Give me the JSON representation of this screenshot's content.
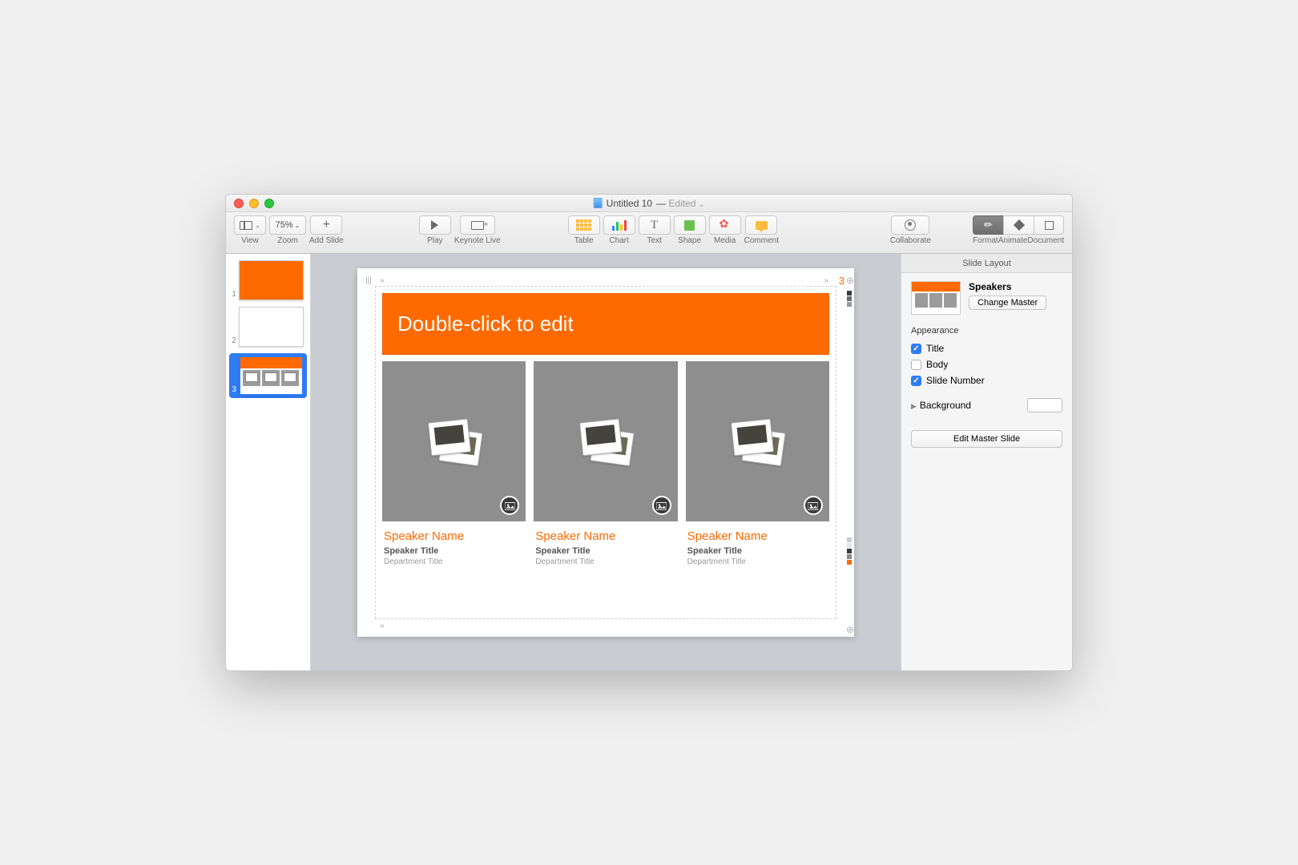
{
  "title": {
    "name": "Untitled 10",
    "status": "Edited"
  },
  "toolbar": {
    "left": {
      "view": "View",
      "zoom_value": "75%",
      "zoom": "Zoom",
      "add_slide": "Add Slide"
    },
    "play": {
      "play": "Play",
      "keynote_live": "Keynote Live"
    },
    "insert": {
      "table": "Table",
      "chart": "Chart",
      "text": "Text",
      "shape": "Shape",
      "media": "Media",
      "comment": "Comment"
    },
    "collab": {
      "collaborate": "Collaborate"
    },
    "right": {
      "format": "Format",
      "animate": "Animate",
      "document": "Document"
    }
  },
  "slidenav": {
    "items": [
      "1",
      "2",
      "3"
    ],
    "selected": 3
  },
  "slide": {
    "number": "3",
    "title_placeholder": "Double-click to edit",
    "speakers": [
      {
        "name": "Speaker Name",
        "title": "Speaker Title",
        "dept": "Department Title"
      },
      {
        "name": "Speaker Name",
        "title": "Speaker Title",
        "dept": "Department Title"
      },
      {
        "name": "Speaker Name",
        "title": "Speaker Title",
        "dept": "Department Title"
      }
    ]
  },
  "inspector": {
    "header": "Slide Layout",
    "master_name": "Speakers",
    "change_master": "Change Master",
    "appearance": "Appearance",
    "checks": {
      "title": "Title",
      "body": "Body",
      "slide_number": "Slide Number"
    },
    "background": "Background",
    "edit_master": "Edit Master Slide"
  },
  "colors": {
    "accent": "#ff6a00",
    "gray": "#8e8e8e"
  }
}
